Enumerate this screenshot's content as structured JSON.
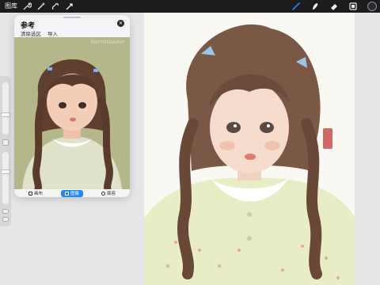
{
  "toolbar": {
    "gallery_label": "图库",
    "tools": [
      {
        "icon": "wrench-icon"
      },
      {
        "icon": "magic-wand-icon"
      },
      {
        "icon": "selection-icon"
      },
      {
        "icon": "transform-arrow-icon"
      },
      {
        "icon": "brush-icon"
      },
      {
        "icon": "smudge-icon"
      },
      {
        "icon": "eraser-icon"
      },
      {
        "icon": "layers-icon"
      },
      {
        "icon": "color-picker-icon"
      }
    ],
    "current_color": "#2b2b2d",
    "active_tool_color": "#1e88ff"
  },
  "reference": {
    "title": "参考",
    "actions": [
      "清除选区",
      "导入"
    ],
    "watermark": "PHOTOGRAPHY",
    "tabs": [
      {
        "label": "画布",
        "icon": "canvas-icon",
        "active": false
      },
      {
        "label": "图像",
        "icon": "image-icon",
        "active": true
      },
      {
        "label": "面容",
        "icon": "face-icon",
        "active": false
      }
    ]
  },
  "colors": {
    "accent": "#1e88ff",
    "toolbar_bg": "#1c1c1e",
    "workspace_bg": "#e6e6e8"
  }
}
